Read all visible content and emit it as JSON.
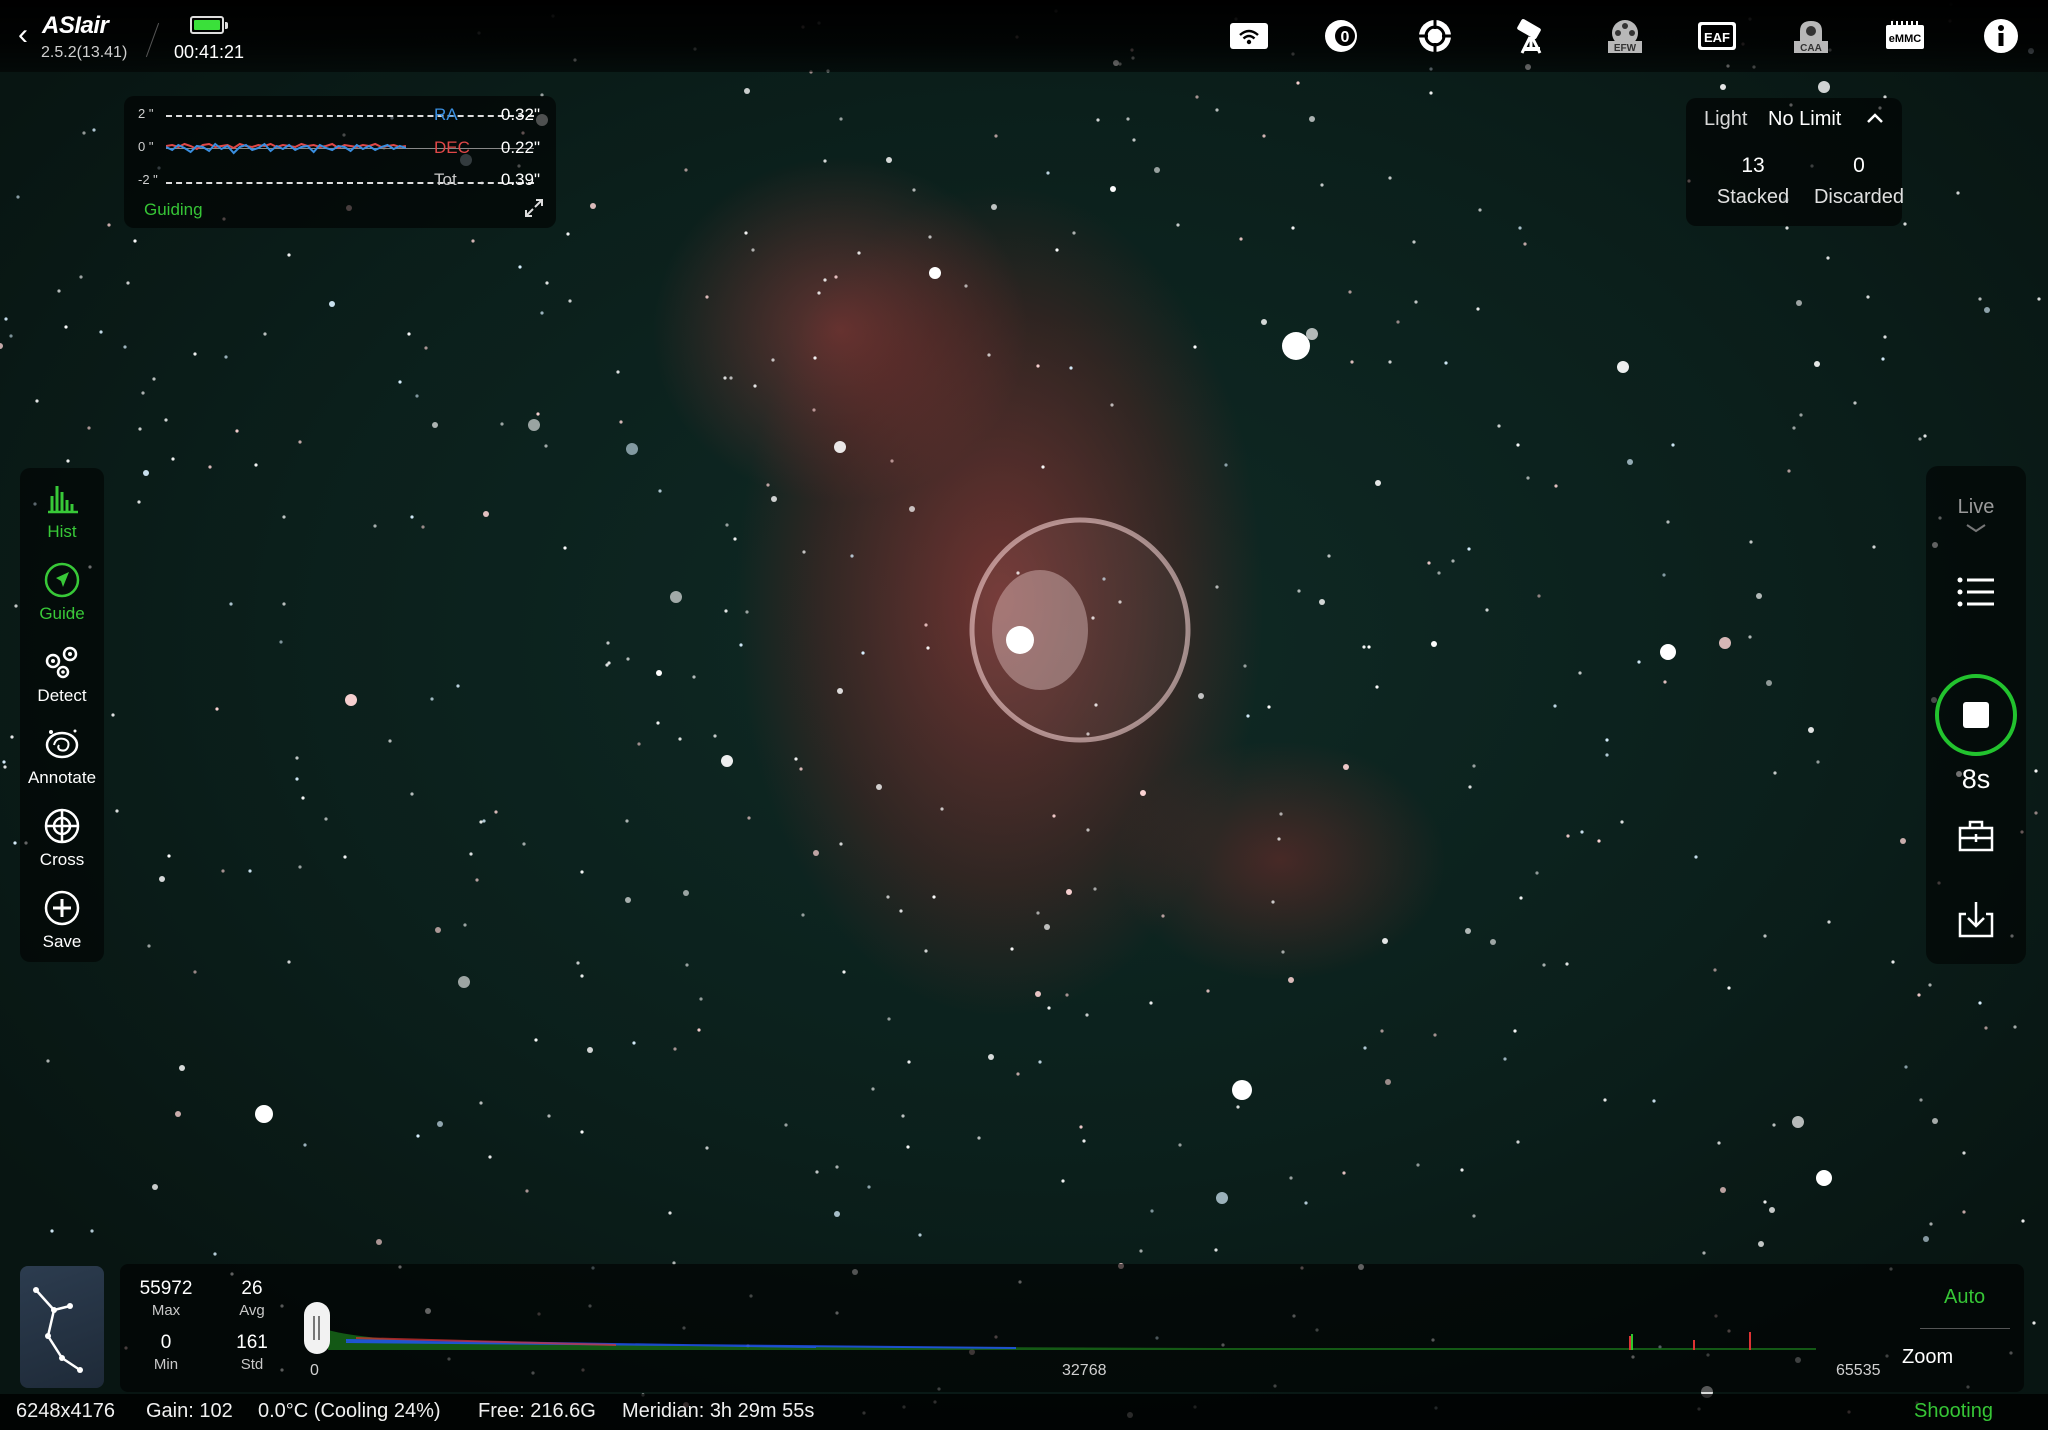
{
  "app": {
    "logo": "ASIair",
    "version": "2.5.2(13.41)",
    "elapsed_time": "00:41:21",
    "battery_level": 1.0
  },
  "top_icons": [
    {
      "name": "wifi-icon",
      "label": ""
    },
    {
      "name": "camera-icon",
      "label": "0"
    },
    {
      "name": "guide-scope-icon",
      "label": ""
    },
    {
      "name": "telescope-mount-icon",
      "label": ""
    },
    {
      "name": "filter-wheel-icon",
      "label": "EFW"
    },
    {
      "name": "focuser-icon",
      "label": "EAF"
    },
    {
      "name": "rotator-icon",
      "label": "CAA"
    },
    {
      "name": "storage-icon",
      "label": "eMMC"
    },
    {
      "name": "info-icon",
      "label": ""
    }
  ],
  "guiding": {
    "status": "Guiding",
    "y_top": "2 \"",
    "y_mid": "0 \"",
    "y_bottom": "-2 \"",
    "ra_label": "RA",
    "ra_value": "0.32\"",
    "dec_label": "DEC",
    "dec_value": "0.22\"",
    "tot_label": "Tot",
    "tot_value": "0.39\"",
    "ra_color": "#3a8fe0",
    "dec_color": "#e04848",
    "ra_trace": [
      0.1,
      -0.2,
      0.3,
      0.0,
      -0.4,
      0.2,
      0.1,
      -0.3,
      0.4,
      -0.1,
      0.2,
      -0.5,
      0.1,
      0.3,
      -0.2,
      0.0,
      0.4,
      -0.3,
      0.2,
      -0.1,
      0.3,
      -0.2,
      0.1,
      0.2,
      -0.4,
      0.3,
      0.0,
      -0.2,
      0.2,
      0.1,
      -0.3,
      0.3,
      -0.1,
      0.2,
      -0.2,
      0.1,
      0.3,
      -0.1,
      0.2,
      0.0
    ],
    "dec_trace": [
      0.2,
      0.3,
      0.1,
      0.4,
      0.2,
      -0.1,
      0.3,
      0.4,
      0.1,
      0.2,
      0.3,
      0.0,
      0.4,
      0.2,
      0.1,
      0.3,
      0.2,
      0.4,
      0.1,
      0.3,
      0.2,
      0.1,
      0.4,
      0.2,
      0.3,
      0.1,
      0.2,
      0.4,
      0.0,
      0.3,
      0.2,
      0.1,
      0.3,
      0.2,
      0.4,
      0.1,
      0.2,
      0.3,
      0.1,
      0.2
    ]
  },
  "stacking": {
    "frame_type": "Light",
    "limit": "No Limit",
    "stacked_count": "13",
    "stacked_label": "Stacked",
    "discarded_count": "0",
    "discarded_label": "Discarded"
  },
  "left_tools": [
    {
      "name": "hist",
      "label": "Hist",
      "active": true
    },
    {
      "name": "guide",
      "label": "Guide",
      "active": true
    },
    {
      "name": "detect",
      "label": "Detect",
      "active": false
    },
    {
      "name": "annotate",
      "label": "Annotate",
      "active": false
    },
    {
      "name": "cross",
      "label": "Cross",
      "active": false
    },
    {
      "name": "save",
      "label": "Save",
      "active": false
    }
  ],
  "right_panel": {
    "mode": "Live",
    "exposure": "8s"
  },
  "histogram": {
    "max_value": "55972",
    "max_label": "Max",
    "avg_value": "26",
    "avg_label": "Avg",
    "min_value": "0",
    "min_label": "Min",
    "std_value": "161",
    "std_label": "Std",
    "axis_start": "0",
    "axis_mid": "32768",
    "axis_end": "65535",
    "auto_label": "Auto",
    "zoom_label": "Zoom"
  },
  "status_bar": {
    "resolution": "6248x4176",
    "gain": "Gain: 102",
    "temperature": "0.0°C (Cooling 24%)",
    "free_space": "Free: 216.6G",
    "meridian": "Meridian: 3h 29m 55s",
    "state": "Shooting"
  },
  "colors": {
    "accent_green": "#36c536",
    "stop_ring": "#22c32e"
  }
}
